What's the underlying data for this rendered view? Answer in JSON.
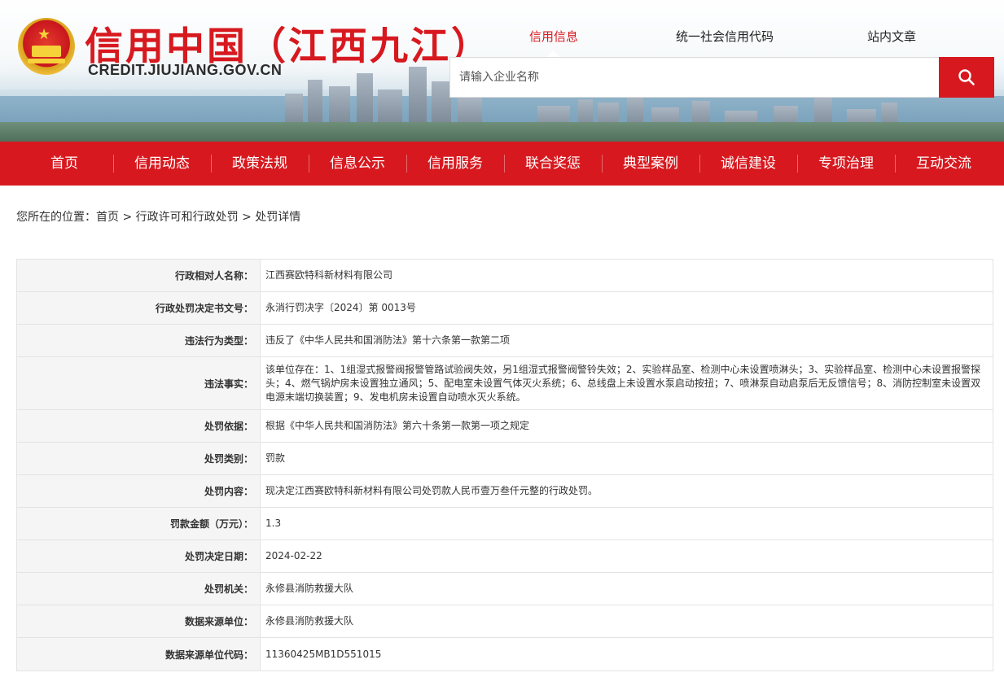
{
  "header": {
    "site_title": "信用中国（江西九江）",
    "site_domain": "CREDIT.JIUJIANG.GOV.CN",
    "search_tabs": [
      "信用信息",
      "统一社会信用代码",
      "站内文章"
    ],
    "active_tab_index": 0,
    "search_placeholder": "请输入企业名称"
  },
  "nav": {
    "items": [
      "首页",
      "信用动态",
      "政策法规",
      "信息公示",
      "信用服务",
      "联合奖惩",
      "典型案例",
      "诚信建设",
      "专项治理",
      "互动交流"
    ]
  },
  "breadcrumb": {
    "prefix": "您所在的位置：",
    "items": [
      "首页",
      "行政许可和行政处罚",
      "处罚详情"
    ],
    "separator": " > "
  },
  "detail": {
    "rows": [
      {
        "label": "行政相对人名称：",
        "value": "江西赛欧特科新材料有限公司"
      },
      {
        "label": "行政处罚决定书文号：",
        "value": "永消行罚决字〔2024〕第 0013号"
      },
      {
        "label": "违法行为类型：",
        "value": "违反了《中华人民共和国消防法》第十六条第一款第二项"
      },
      {
        "label": "违法事实：",
        "value": "该单位存在：1、1组湿式报警阀报警管路试验阀失效，另1组湿式报警阀警铃失效；2、实验样品室、检测中心未设置喷淋头；3、实验样品室、检测中心未设置报警探头；4、燃气锅炉房未设置独立通风；5、配电室未设置气体灭火系统；6、总线盘上未设置水泵启动按扭；7、喷淋泵自动启泵后无反馈信号；8、消防控制室未设置双电源末端切换装置；9、发电机房未设置自动喷水灭火系统。"
      },
      {
        "label": "处罚依据：",
        "value": "根据《中华人民共和国消防法》第六十条第一款第一项之规定"
      },
      {
        "label": "处罚类别：",
        "value": "罚款"
      },
      {
        "label": "处罚内容：",
        "value": "现决定江西赛欧特科新材料有限公司处罚款人民币壹万叁仟元整的行政处罚。"
      },
      {
        "label": "罚款金额（万元）：",
        "value": "1.3"
      },
      {
        "label": "处罚决定日期：",
        "value": "2024-02-22"
      },
      {
        "label": "处罚机关：",
        "value": "永修县消防救援大队"
      },
      {
        "label": "数据来源单位：",
        "value": "永修县消防救援大队"
      },
      {
        "label": "数据来源单位代码：",
        "value": "11360425MB1D551015"
      }
    ]
  },
  "colors": {
    "brand_red": "#d7191f",
    "label_bg": "#f5f5f5",
    "border": "#e3e3e3"
  },
  "icons": {
    "search": "search-icon",
    "emblem": "national-emblem-icon"
  }
}
